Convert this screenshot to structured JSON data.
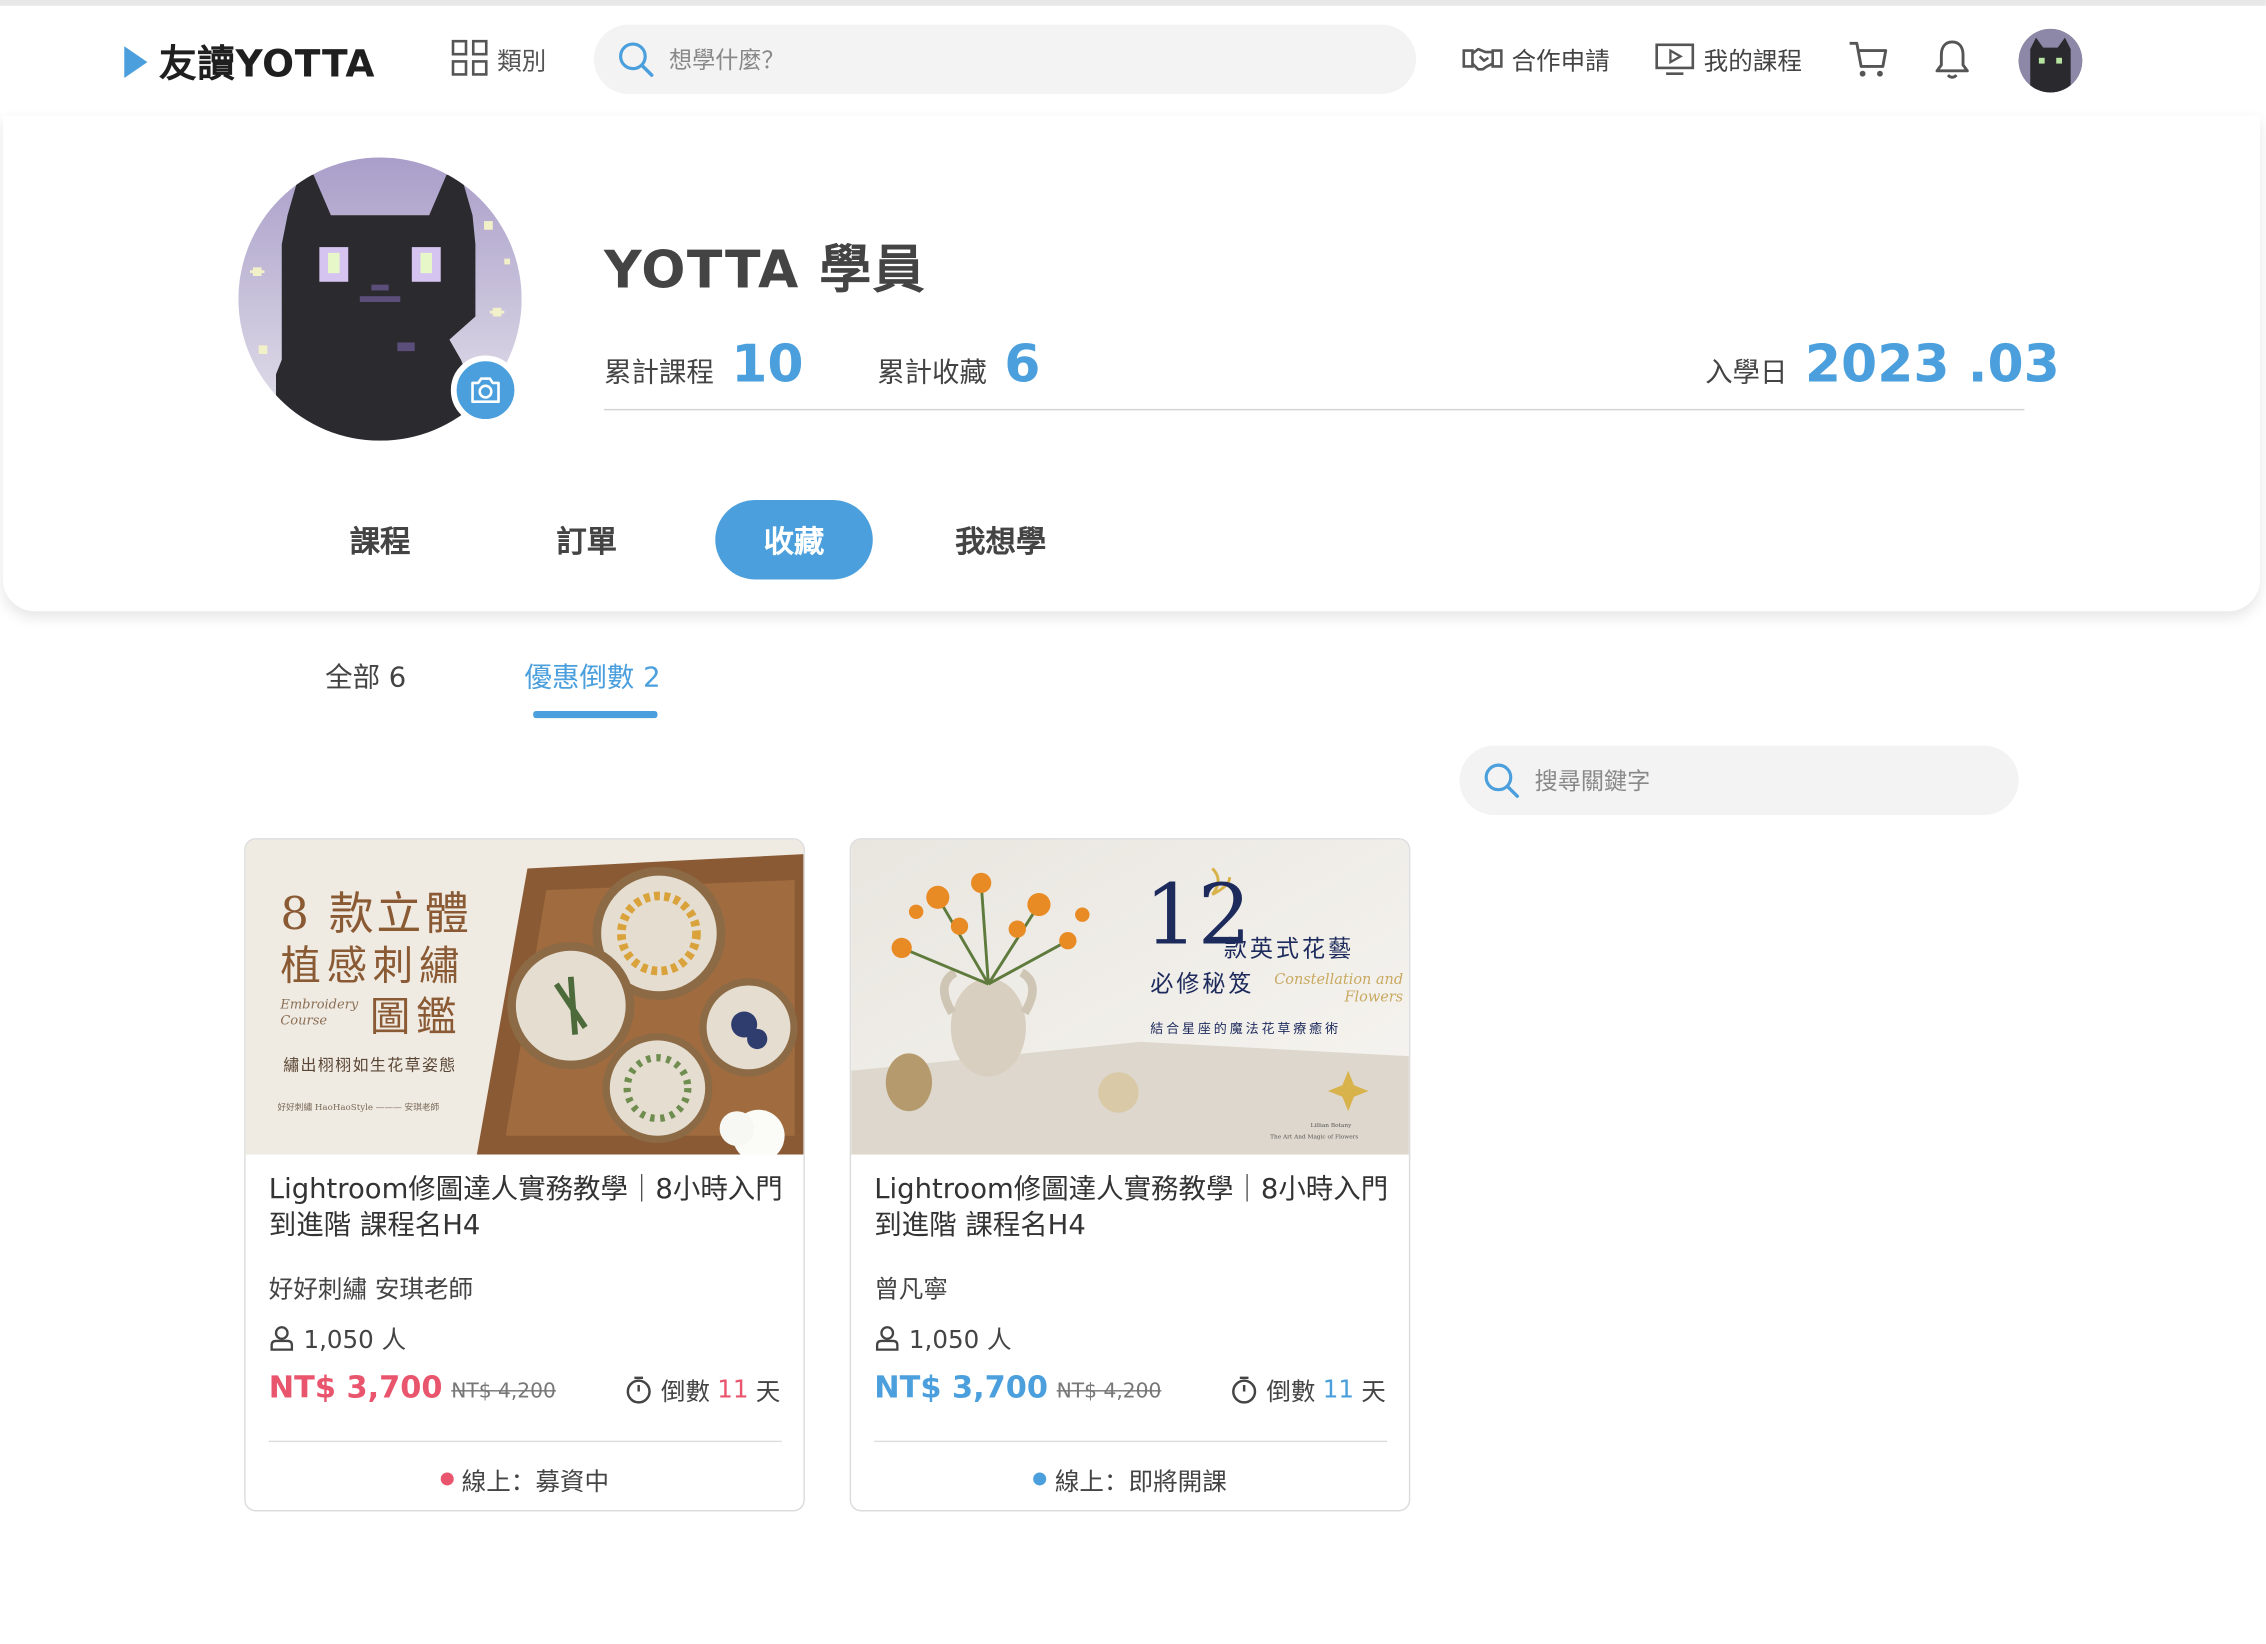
{
  "header": {
    "logo_text": "友讀YOTTA",
    "category_label": "類別",
    "search_placeholder": "想學什麼？",
    "partner_label": "合作申請",
    "my_courses_label": "我的課程"
  },
  "profile": {
    "name": "YOTTA 學員",
    "courses_label": "累計課程",
    "courses_count": "10",
    "favorites_label": "累計收藏",
    "favorites_count": "6",
    "enroll_label": "入學日",
    "enroll_date": "2023 .03"
  },
  "tabs": [
    {
      "label": "課程",
      "active": false
    },
    {
      "label": "訂單",
      "active": false
    },
    {
      "label": "收藏",
      "active": true
    },
    {
      "label": "我想學",
      "active": false
    }
  ],
  "subtabs": [
    {
      "label": "全部 6",
      "active": false
    },
    {
      "label": "優惠倒數 2",
      "active": true
    }
  ],
  "keyword_search_placeholder": "搜尋關鍵字",
  "colors": {
    "accent": "#4a9fdc",
    "sale_red": "#e8556d"
  },
  "courses": [
    {
      "image": {
        "line1": "8 款立體",
        "line2": "植感刺繡",
        "line3": "圖鑑",
        "subtitle": "繡出栩栩如生花草姿態",
        "eng": "Embroidery Course",
        "footer": "好好刺繡 HaoHaoStyle ——— 安琪老師"
      },
      "title": "Lightroom修圖達人實務教學｜8小時入門到進階 課程名H4",
      "instructor": "好好刺繡 安琪老師",
      "students": "1,050 人",
      "price": "NT$ 3,700",
      "original_price": "NT$ 4,200",
      "countdown_label": "倒數",
      "countdown_days": "11",
      "countdown_unit": "天",
      "status": "線上：募資中",
      "status_color": "#e8556d",
      "price_color": "#e8556d"
    },
    {
      "image": {
        "big_num": "12",
        "line1": "款英式花藝",
        "line2": "必修秘笈",
        "script": "Constellation and Flowers",
        "subtitle": "結合星座的魔法花草療癒術",
        "credit1": "Lillian Botany",
        "credit2": "The Art And Magic of Flowers"
      },
      "title": "Lightroom修圖達人實務教學｜8小時入門到進階 課程名H4",
      "instructor": "曾凡寧",
      "students": "1,050 人",
      "price": "NT$ 3,700",
      "original_price": "NT$ 4,200",
      "countdown_label": "倒數",
      "countdown_days": "11",
      "countdown_unit": "天",
      "status": "線上：即將開課",
      "status_color": "#4a9fdc",
      "price_color": "#4a9fdc"
    }
  ]
}
